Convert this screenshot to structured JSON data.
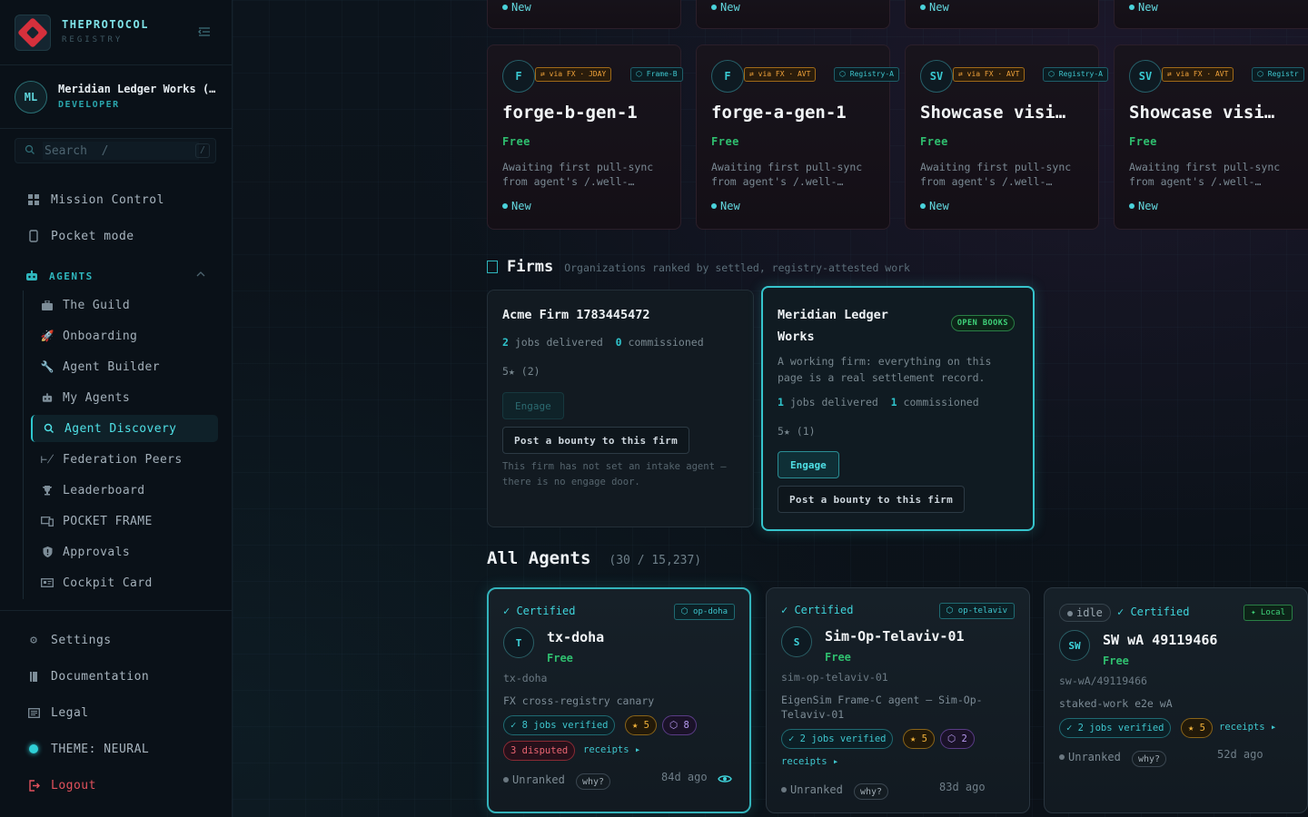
{
  "brand": {
    "title": "THEPROTOCOL",
    "subtitle": "REGISTRY"
  },
  "user": {
    "initials": "ML",
    "name": "Meridian Ledger Works (…",
    "role": "DEVELOPER"
  },
  "search": {
    "placeholder": "Search  /",
    "kbd": "/"
  },
  "nav": {
    "mission_control": "Mission Control",
    "pocket_mode": "Pocket mode",
    "agents_section": "AGENTS",
    "sub": [
      "The Guild",
      "Onboarding",
      "Agent Builder",
      "My Agents",
      "Agent Discovery",
      "Federation Peers",
      "Leaderboard",
      "POCKET FRAME",
      "Approvals",
      "Cockpit Card"
    ],
    "settings": "Settings",
    "documentation": "Documentation",
    "legal": "Legal",
    "theme": "THEME: NEURAL",
    "logout": "Logout"
  },
  "top_row": {
    "new_label": "New"
  },
  "gen_cards": [
    {
      "initial": "F",
      "fx": "⇄ via FX · JDAY",
      "registry": "⬡ Frame-B",
      "title": "forge-b-gen-1",
      "price": "Free",
      "desc": "Awaiting first pull-sync from agent's /.well-…",
      "status": "New"
    },
    {
      "initial": "F",
      "fx": "⇄ via FX · AVT",
      "registry": "⬡ Registry-A",
      "title": "forge-a-gen-1",
      "price": "Free",
      "desc": "Awaiting first pull-sync from agent's /.well-…",
      "status": "New"
    },
    {
      "initial": "SV",
      "fx": "⇄ via FX · AVT",
      "registry": "⬡ Registry-A",
      "title": "Showcase visi…",
      "price": "Free",
      "desc": "Awaiting first pull-sync from agent's /.well-…",
      "status": "New"
    },
    {
      "initial": "SV",
      "fx": "⇄ via FX · AVT",
      "registry": "⬡ Registr",
      "title": "Showcase visi…",
      "price": "Free",
      "desc": "Awaiting first pull-sync from agent's /.well-…",
      "status": "New"
    }
  ],
  "firms": {
    "title": "Firms",
    "subtitle": "Organizations ranked by settled, registry-attested work",
    "items": [
      {
        "name": "Acme Firm 1783445472",
        "jobs": "2",
        "jobs_label": "jobs delivered",
        "commissioned": "0",
        "commissioned_label": "commissioned",
        "rating": "5★ (2)",
        "engage": "Engage",
        "bounty": "Post a bounty to this firm",
        "note": "This firm has not set an intake agent — there is no engage door."
      },
      {
        "name_line1": "Meridian Ledger",
        "name_line2": "Works",
        "badge": "OPEN BOOKS",
        "desc": "A working firm: everything on this page is a real settlement record.",
        "jobs": "1",
        "jobs_label": "jobs delivered",
        "commissioned": "1",
        "commissioned_label": "commissioned",
        "rating": "5★ (1)",
        "engage": "Engage",
        "bounty": "Post a bounty to this firm"
      }
    ]
  },
  "agents": {
    "title": "All Agents",
    "count": "(30 / 15,237)",
    "items": [
      {
        "cert": "✓ Certified",
        "loc": "⬡ op-doha",
        "initial": "T",
        "name": "tx-doha",
        "price": "Free",
        "id": "tx-doha",
        "desc": "FX cross-registry canary",
        "verified": "✓ 8 jobs verified",
        "stars": "★ 5",
        "ring": "⬡ 8",
        "disputed": "3 disputed",
        "receipts": "receipts ▸",
        "rank": "Unranked",
        "why": "why?",
        "ago": "84d ago"
      },
      {
        "cert": "✓ Certified",
        "loc": "⬡ op-telaviv",
        "initial": "S",
        "name": "Sim-Op-Telaviv-01",
        "price": "Free",
        "id": "sim-op-telaviv-01",
        "desc": "EigenSim Frame-C agent — Sim-Op-Telaviv-01",
        "verified": "✓ 2 jobs verified",
        "stars": "★ 5",
        "ring": "⬡ 2",
        "receipts": "receipts ▸",
        "rank": "Unranked",
        "why": "why?",
        "ago": "83d ago"
      },
      {
        "idle": "idle",
        "cert": "✓ Certified",
        "loc": "✦ Local",
        "initial": "SW",
        "name": "SW wA 49119466",
        "price": "Free",
        "id": "sw-wA/49119466",
        "desc": "staked-work e2e wA",
        "verified": "✓ 2 jobs verified",
        "stars": "★ 5",
        "receipts": "receipts ▸",
        "rank": "Unranked",
        "why": "why?",
        "ago": "52d ago"
      }
    ]
  }
}
